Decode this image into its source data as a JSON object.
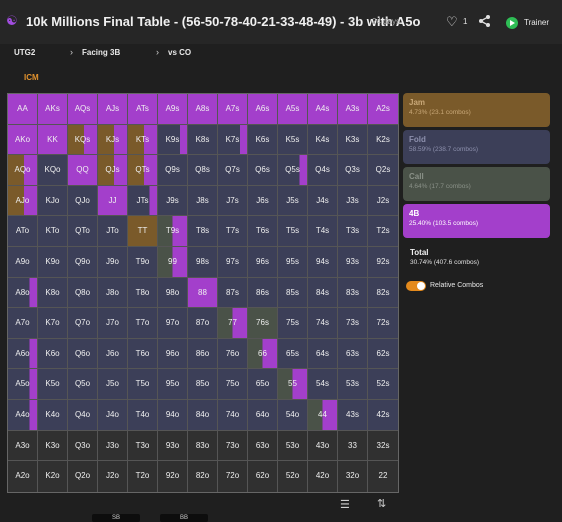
{
  "header": {
    "title": "10k Millions Final Table - (56-50-78-40-21-33-48-49) - 3b with A5o",
    "age": "24 days",
    "likes": "1",
    "trainer_label": "Trainer"
  },
  "nav": {
    "items": [
      {
        "label": "UTG2"
      },
      {
        "label": "Facing 3B"
      },
      {
        "label": "vs CO"
      }
    ]
  },
  "mode_label": "ICM",
  "colors": {
    "jam": "#7a5a2a",
    "fold": "#3c3f58",
    "call": "#4a5248",
    "bet": "#a33fcb",
    "empty": "#303030",
    "accent": "#e48a1c"
  },
  "grid": {
    "rows": [
      [
        "AA",
        "AKs",
        "AQs",
        "AJs",
        "ATs",
        "A9s",
        "A8s",
        "A7s",
        "A6s",
        "A5s",
        "A4s",
        "A3s",
        "A2s"
      ],
      [
        "AKo",
        "KK",
        "KQs",
        "KJs",
        "KTs",
        "K9s",
        "K8s",
        "K7s",
        "K6s",
        "K5s",
        "K4s",
        "K3s",
        "K2s"
      ],
      [
        "AQo",
        "KQo",
        "QQ",
        "QJs",
        "QTs",
        "Q9s",
        "Q8s",
        "Q7s",
        "Q6s",
        "Q5s",
        "Q4s",
        "Q3s",
        "Q2s"
      ],
      [
        "AJo",
        "KJo",
        "QJo",
        "JJ",
        "JTs",
        "J9s",
        "J8s",
        "J7s",
        "J6s",
        "J5s",
        "J4s",
        "J3s",
        "J2s"
      ],
      [
        "ATo",
        "KTo",
        "QTo",
        "JTo",
        "TT",
        "T9s",
        "T8s",
        "T7s",
        "T6s",
        "T5s",
        "T4s",
        "T3s",
        "T2s"
      ],
      [
        "A9o",
        "K9o",
        "Q9o",
        "J9o",
        "T9o",
        "99",
        "98s",
        "97s",
        "96s",
        "95s",
        "94s",
        "93s",
        "92s"
      ],
      [
        "A8o",
        "K8o",
        "Q8o",
        "J8o",
        "T8o",
        "98o",
        "88",
        "87s",
        "86s",
        "85s",
        "84s",
        "83s",
        "82s"
      ],
      [
        "A7o",
        "K7o",
        "Q7o",
        "J7o",
        "T7o",
        "97o",
        "87o",
        "77",
        "76s",
        "75s",
        "74s",
        "73s",
        "72s"
      ],
      [
        "A6o",
        "K6o",
        "Q6o",
        "J6o",
        "T6o",
        "96o",
        "86o",
        "76o",
        "66",
        "65s",
        "64s",
        "63s",
        "62s"
      ],
      [
        "A5o",
        "K5o",
        "Q5o",
        "J5o",
        "T5o",
        "95o",
        "85o",
        "75o",
        "65o",
        "55",
        "54s",
        "53s",
        "52s"
      ],
      [
        "A4o",
        "K4o",
        "Q4o",
        "J4o",
        "T4o",
        "94o",
        "84o",
        "74o",
        "64o",
        "54o",
        "44",
        "43s",
        "42s"
      ],
      [
        "A3o",
        "K3o",
        "Q3o",
        "J3o",
        "T3o",
        "93o",
        "83o",
        "73o",
        "63o",
        "53o",
        "43o",
        "33",
        "32s"
      ],
      [
        "A2o",
        "K2o",
        "Q2o",
        "J2o",
        "T2o",
        "92o",
        "82o",
        "72o",
        "62o",
        "52o",
        "42o",
        "32o",
        "22"
      ]
    ],
    "cells": {
      "AA": "B",
      "AKs": "B",
      "AQs": "B",
      "AJs": "B",
      "ATs": "B",
      "A9s": "B",
      "A8s": "B",
      "A7s": "B",
      "A6s": "B",
      "A5s": "B",
      "A4s": "B",
      "A3s": "B",
      "A2s": "B",
      "AKo": "B",
      "KK": "B",
      "KQs": "JB",
      "KJs": "JB",
      "KTs": "JB",
      "K9s": "FB",
      "K8s": "F",
      "K7s": "FB",
      "K6s": "F",
      "K5s": "F",
      "K4s": "F",
      "K3s": "F",
      "K2s": "F",
      "AQo": "JB",
      "KQo": "F",
      "QQ": "B",
      "QJs": "JB",
      "QTs": "JB",
      "Q9s": "F",
      "Q8s": "F",
      "Q7s": "F",
      "Q6s": "F",
      "Q5s": "FB",
      "Q4s": "F",
      "Q3s": "F",
      "Q2s": "F",
      "AJo": "JB",
      "KJo": "F",
      "QJo": "F",
      "JJ": "B",
      "JTs": "FB",
      "J9s": "F",
      "J8s": "F",
      "J7s": "F",
      "J6s": "F",
      "J5s": "F",
      "J4s": "F",
      "J3s": "F",
      "J2s": "F",
      "ATo": "F",
      "KTo": "F",
      "QTo": "F",
      "JTo": "F",
      "TT": "J",
      "T9s": "CB",
      "T8s": "F",
      "T7s": "F",
      "T6s": "F",
      "T5s": "F",
      "T4s": "F",
      "T3s": "F",
      "T2s": "F",
      "A9o": "F",
      "K9o": "F",
      "Q9o": "F",
      "J9o": "F",
      "T9o": "F",
      "99": "CB",
      "98s": "F",
      "97s": "F",
      "96s": "F",
      "95s": "F",
      "94s": "F",
      "93s": "F",
      "92s": "F",
      "A8o": "FB",
      "K8o": "F",
      "Q8o": "F",
      "J8o": "F",
      "T8o": "F",
      "98o": "F",
      "88": "B",
      "87s": "F",
      "86s": "F",
      "85s": "F",
      "84s": "F",
      "83s": "F",
      "82s": "F",
      "A7o": "F",
      "K7o": "F",
      "Q7o": "F",
      "J7o": "F",
      "T7o": "F",
      "97o": "F",
      "87o": "F",
      "77": "CB",
      "76s": "C",
      "75s": "F",
      "74s": "F",
      "73s": "F",
      "72s": "F",
      "A6o": "FB",
      "K6o": "F",
      "Q6o": "F",
      "J6o": "F",
      "T6o": "F",
      "96o": "F",
      "86o": "F",
      "76o": "F",
      "66": "CB",
      "65s": "F",
      "64s": "F",
      "63s": "F",
      "62s": "F",
      "A5o": "FB",
      "K5o": "F",
      "Q5o": "F",
      "J5o": "F",
      "T5o": "F",
      "95o": "F",
      "85o": "F",
      "75o": "F",
      "65o": "F",
      "55": "CB",
      "54s": "F",
      "53s": "F",
      "52s": "F",
      "A4o": "FB",
      "K4o": "F",
      "Q4o": "F",
      "J4o": "F",
      "T4o": "F",
      "94o": "F",
      "84o": "F",
      "74o": "F",
      "64o": "F",
      "54o": "F",
      "44": "CB",
      "43s": "F",
      "42s": "F",
      "A3o": "E",
      "K3o": "E",
      "Q3o": "E",
      "J3o": "E",
      "T3o": "E",
      "93o": "E",
      "83o": "E",
      "73o": "E",
      "63o": "E",
      "53o": "E",
      "43o": "E",
      "33": "E",
      "32s": "E",
      "A2o": "E",
      "K2o": "E",
      "Q2o": "E",
      "J2o": "E",
      "T2o": "E",
      "92o": "E",
      "82o": "E",
      "72o": "E",
      "62o": "E",
      "52o": "E",
      "42o": "E",
      "32o": "E",
      "22": "E"
    }
  },
  "actions": {
    "jam": {
      "name": "Jam",
      "detail": "4.73% (23.1 combos)"
    },
    "fold": {
      "name": "Fold",
      "detail": "58.59% (238.7 combos)"
    },
    "call": {
      "name": "Call",
      "detail": "4.64% (17.7 combos)"
    },
    "bet": {
      "name": "4B",
      "detail": "25.40% (103.5 combos)"
    }
  },
  "total": {
    "name": "Total",
    "detail": "30.74% (407.6 combos)"
  },
  "relative_combos_label": "Relative Combos",
  "seats": [
    {
      "label": "SB"
    },
    {
      "label": "BB"
    }
  ]
}
